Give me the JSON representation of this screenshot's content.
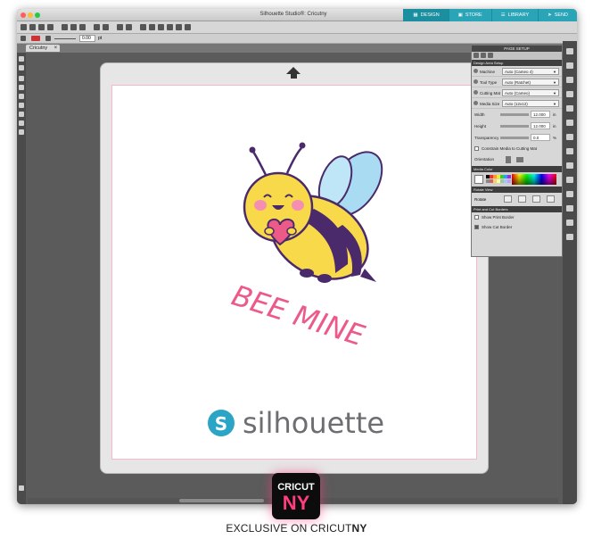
{
  "window": {
    "title": "Silhouette Studio®: Cricutny"
  },
  "nav_tabs": [
    {
      "label": "DESIGN",
      "icon": "design-icon",
      "active": true
    },
    {
      "label": "STORE",
      "icon": "store-icon",
      "active": false
    },
    {
      "label": "LIBRARY",
      "icon": "library-icon",
      "active": false
    },
    {
      "label": "SEND",
      "icon": "send-icon",
      "active": false
    }
  ],
  "toolbar2": {
    "value": "0.00",
    "unit": "pt"
  },
  "document_tab": {
    "label": "Cricutny"
  },
  "panel": {
    "title": "PAGE SETUP",
    "design_area_setup": "Design Area Setup",
    "rows": [
      {
        "label": "Machine",
        "value": "Auto (Cameo 4)"
      },
      {
        "label": "Tool Type",
        "value": "Auto (Ratchet)"
      },
      {
        "label": "Cutting Mat",
        "value": "Auto (Cameo)"
      },
      {
        "label": "Media Size",
        "value": "Auto (12x12)"
      }
    ],
    "width": {
      "label": "Width",
      "value": "12.000",
      "unit": "in"
    },
    "height": {
      "label": "Height",
      "value": "12.000",
      "unit": "in"
    },
    "transparency": {
      "label": "Transparency",
      "value": "0.0",
      "unit": "%"
    },
    "constrain": "Constrain Media to Cutting Mat",
    "orientation": "Orientation",
    "media_color": "Media Color",
    "rotate_view": "Rotate View",
    "rotate": "Rotate",
    "print_cut_borders": "Print and Cut Borders",
    "show_print_border": "Show Print Border",
    "show_cut_border": "Show Cut Border"
  },
  "design": {
    "text": "BEE MINE",
    "brand": "silhouette",
    "colors": {
      "pink": "#ec5a88",
      "yellow": "#f7d94a",
      "purple": "#4a2a6b",
      "wing": "#a9dcf2",
      "brand_teal": "#2aa5c5"
    }
  },
  "badge": {
    "top": "CRICUT",
    "bottom": "NY"
  },
  "caption": {
    "prefix": "EXCLUSIVE ON CRICUT",
    "suffix": "NY"
  }
}
